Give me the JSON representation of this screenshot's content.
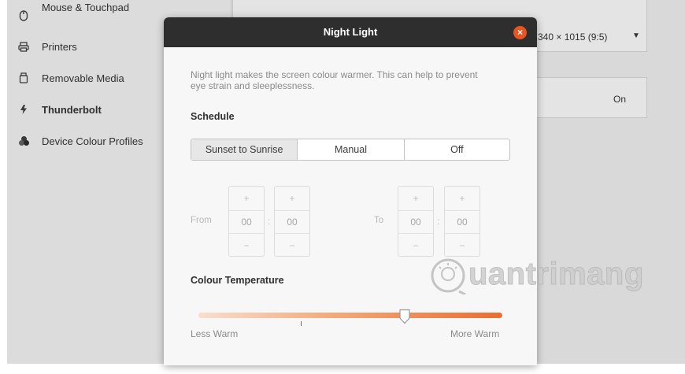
{
  "sidebar": {
    "items": [
      {
        "label": "Mouse & Touchpad",
        "icon": "mouse-icon"
      },
      {
        "label": "Printers",
        "icon": "printer-icon"
      },
      {
        "label": "Removable Media",
        "icon": "removable-media-icon"
      },
      {
        "label": "Thunderbolt",
        "icon": "thunderbolt-icon"
      },
      {
        "label": "Device Colour Profiles",
        "icon": "colour-profiles-icon"
      }
    ]
  },
  "background": {
    "resolution_value": "340 × 1015 (9:5)",
    "night_light_status": "On"
  },
  "dialog": {
    "title": "Night Light",
    "description": "Night light makes the screen colour warmer. This can help to prevent eye strain and sleeplessness.",
    "schedule_heading": "Schedule",
    "schedule_options": [
      "Sunset to Sunrise",
      "Manual",
      "Off"
    ],
    "schedule_selected": "Sunset to Sunrise",
    "from_label": "From",
    "to_label": "To",
    "from_hours": "00",
    "from_minutes": "00",
    "to_hours": "00",
    "to_minutes": "00",
    "increment_glyph": "+",
    "decrement_glyph": "−",
    "separator": ":",
    "temperature_heading": "Colour Temperature",
    "less_warm_label": "Less Warm",
    "more_warm_label": "More Warm",
    "temperature_fraction": 0.68
  },
  "watermark": {
    "text": "uantrimang"
  },
  "colors": {
    "accent": "#e95420",
    "titlebar": "#2e2e2e"
  }
}
